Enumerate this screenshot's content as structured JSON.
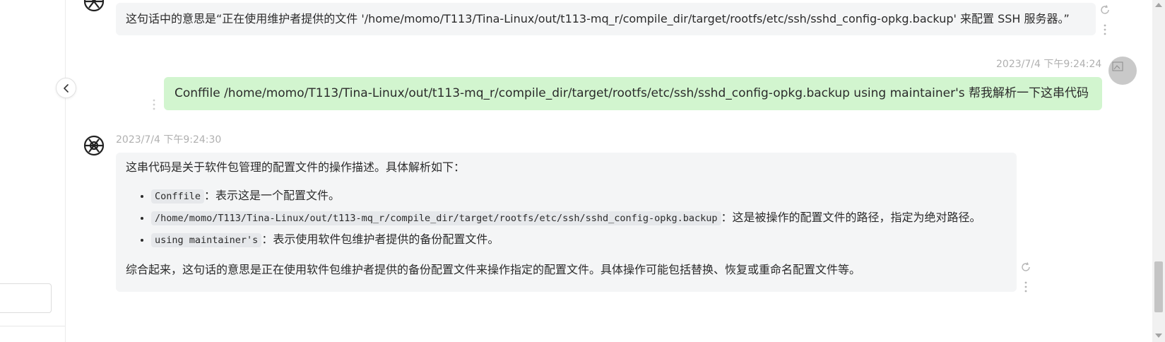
{
  "colors": {
    "bot_bubble": "#f4f5f6",
    "user_bubble": "#d2f5cf",
    "timestamp": "#b0b0b0",
    "code_bg": "#e6e8eb"
  },
  "messages": {
    "bot_top": {
      "text": "这句话中的意思是“正在使用维护者提供的文件 '/home/momo/T113/Tina-Linux/out/t113-mq_r/compile_dir/target/rootfs/etc/ssh/sshd_config-opkg.backup' 来配置 SSH 服务器。”"
    },
    "user": {
      "timestamp": "2023/7/4 下午9:24:24",
      "text": "Conffile /home/momo/T113/Tina-Linux/out/t113-mq_r/compile_dir/target/rootfs/etc/ssh/sshd_config-opkg.backup using maintainer's 帮我解析一下这串代码"
    },
    "bot_reply": {
      "timestamp": "2023/7/4 下午9:24:30",
      "intro": "这串代码是关于软件包管理的配置文件的操作描述。具体解析如下：",
      "items": [
        {
          "code": "Conffile",
          "desc": "：表示这是一个配置文件。"
        },
        {
          "code": "/home/momo/T113/Tina-Linux/out/t113-mq_r/compile_dir/target/rootfs/etc/ssh/sshd_config-opkg.backup",
          "desc": "：这是被操作的配置文件的路径，指定为绝对路径。"
        },
        {
          "code": "using maintainer's",
          "desc": "：表示使用软件包维护者提供的备份配置文件。"
        }
      ],
      "summary": "综合起来，这句话的意思是正在使用软件包维护者提供的备份配置文件来操作指定的配置文件。具体操作可能包括替换、恢复或重命名配置文件等。"
    }
  },
  "icons": {
    "bot_avatar": "openai-logo-icon",
    "refresh": "refresh-icon",
    "more": "more-vertical-icon",
    "collapse": "chevron-left-icon"
  }
}
